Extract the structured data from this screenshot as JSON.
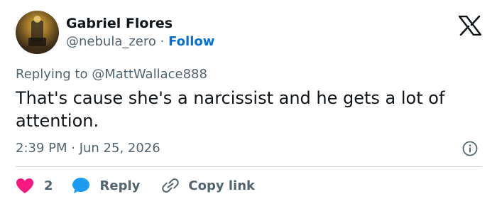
{
  "author": {
    "name": "Gabriel Flores",
    "handle": "@nebula_zero",
    "separator": "·",
    "follow_label": "Follow"
  },
  "reply_context": {
    "prefix": "Replying to",
    "mention": "@MattWallace888"
  },
  "tweet": {
    "text": "That's cause she's a narcissist and he gets a lot of attention.",
    "timestamp": "2:39 PM · Jun 25, 2026"
  },
  "actions": {
    "like_count": "2",
    "reply_label": "Reply",
    "copy_label": "Copy link"
  },
  "icons": {
    "brand": "x-logo-icon",
    "info": "info-icon",
    "like": "heart-icon",
    "reply": "speech-bubble-icon",
    "copy": "link-icon"
  },
  "colors": {
    "accent": "#0070d8",
    "like": "#f91880",
    "reply": "#1d9bf0",
    "muted": "#536471",
    "text": "#0f1419"
  }
}
